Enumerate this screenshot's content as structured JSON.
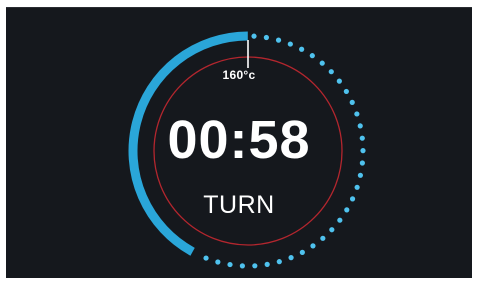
{
  "dial": {
    "temperature_label": "160°c",
    "timer_value": "00:58",
    "status_label": "TURN",
    "progress_fraction": 0.42
  },
  "colors": {
    "background": "#15181d",
    "progress_arc": "#2aa6d9",
    "remaining_dots": "#4fc2ee",
    "inner_ring": "#b3262e",
    "text": "#ffffff"
  },
  "icons": {
    "temperature_marker": "tick-marker-icon"
  }
}
